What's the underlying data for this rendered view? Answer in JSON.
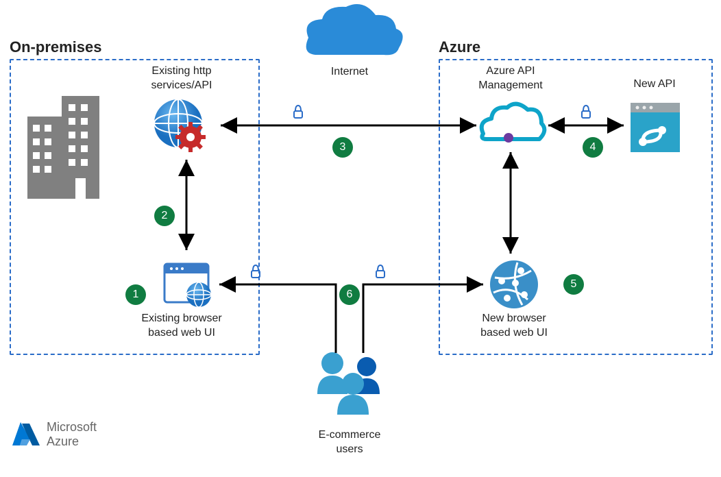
{
  "sections": {
    "onprem": "On-premises",
    "azure": "Azure"
  },
  "nodes": {
    "internet": "Internet",
    "existing_api": "Existing http\nservices/API",
    "existing_ui": "Existing browser\nbased web UI",
    "apim": "Azure API\nManagement",
    "new_api": "New API",
    "new_ui": "New browser\nbased web UI",
    "users": "E-commerce\nusers"
  },
  "badges": {
    "b1": "1",
    "b2": "2",
    "b3": "3",
    "b4": "4",
    "b5": "5",
    "b6": "6"
  },
  "footer": {
    "brand1": "Microsoft",
    "brand2": "Azure"
  }
}
